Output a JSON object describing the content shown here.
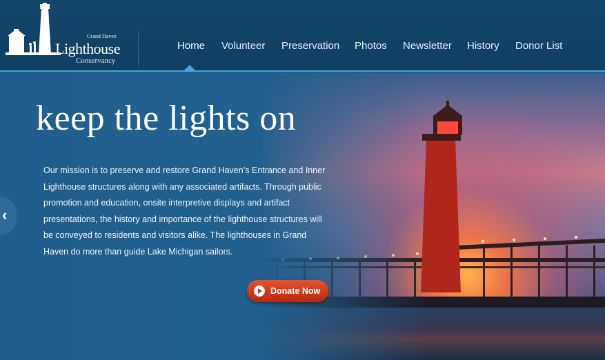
{
  "brand": {
    "name_small": "Grand Haven",
    "name_big": "Lighthouse",
    "name_sub": "Conservancy"
  },
  "nav": {
    "items": [
      {
        "label": "Home"
      },
      {
        "label": "Volunteer"
      },
      {
        "label": "Preservation"
      },
      {
        "label": "Photos"
      },
      {
        "label": "Newsletter"
      },
      {
        "label": "History"
      },
      {
        "label": "Donor List"
      }
    ],
    "active": "Home"
  },
  "hero": {
    "headline": "keep the lights on",
    "mission": "Our mission is to preserve and restore Grand Haven’s Entrance and Inner Lighthouse structures along with any associated artifacts. Through public promotion and education, onsite interpretive displays and artifact presentations, the history and importance of the lighthouse structures will be conveyed to residents and visitors alike. The lighthouses in Grand Haven do more than guide Lake Michigan sailors.",
    "donate_label": "Donate Now",
    "prev_icon": "chevron-left-icon"
  },
  "colors": {
    "header": "#13466b",
    "accent": "#4aa3d6",
    "donate": "#d13a1c",
    "lighthouse": "#b0261b"
  }
}
